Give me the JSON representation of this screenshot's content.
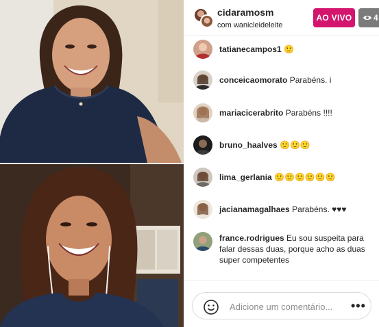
{
  "live": {
    "host_username": "cidaramosm",
    "with_text": "com wanicleideleite",
    "live_badge": "AO VIVO",
    "viewer_count": "4"
  },
  "comments": [
    {
      "user": "tatianecampos1",
      "text": "🙂"
    },
    {
      "user": "conceicaomorato",
      "text": "Parabéns. i"
    },
    {
      "user": "mariacicerabrito",
      "text": "Parabéns !!!!"
    },
    {
      "user": "bruno_haalves",
      "text": "🙂🙂🙂"
    },
    {
      "user": "lima_gerlania",
      "text": "🙂🙂🙂🙂🙂🙂"
    },
    {
      "user": "jacianamagalhaes",
      "text": "Parabéns. ♥♥♥"
    },
    {
      "user": "france.rodrigues",
      "text": "Eu sou suspeita para falar dessas duas, porque acho as duas super competentes"
    }
  ],
  "comment_input": {
    "placeholder": "Adicione um comentário..."
  },
  "icons": {
    "viewers": "eye-icon",
    "emoji": "smiley-icon",
    "more": "more-options-icon"
  },
  "colors": {
    "live_badge": "#d3156e",
    "viewer_badge": "#7b7b7b"
  }
}
